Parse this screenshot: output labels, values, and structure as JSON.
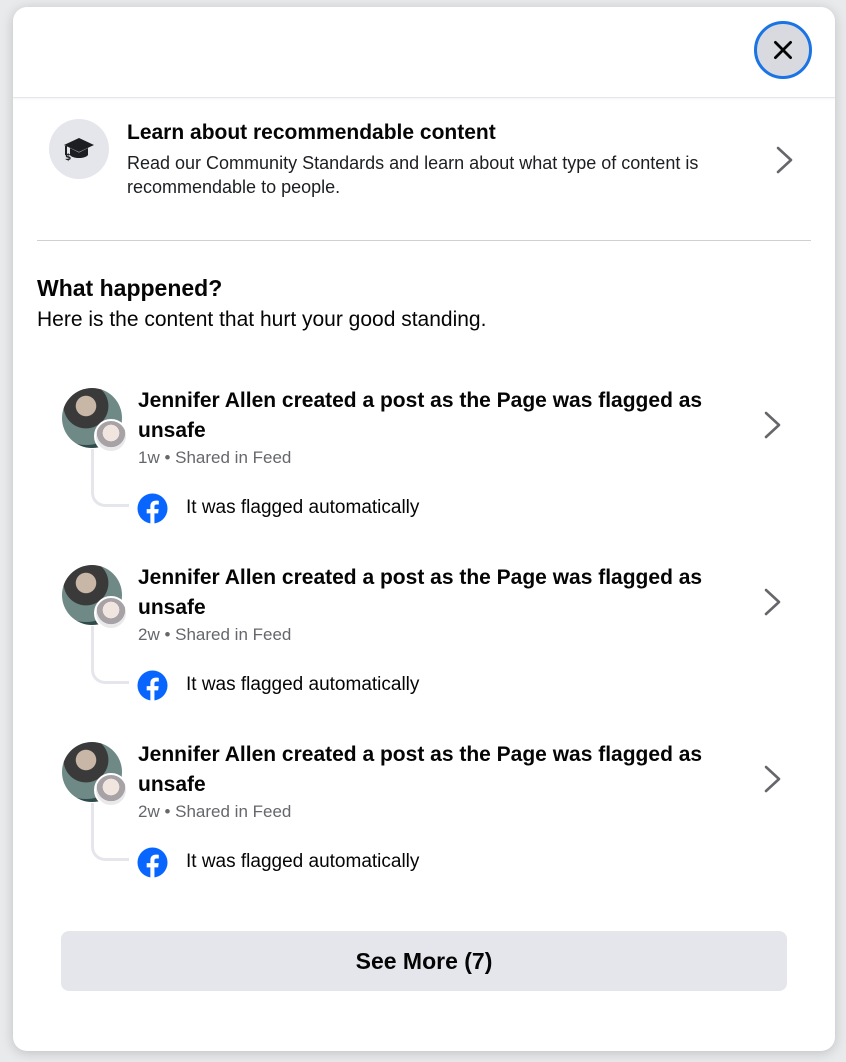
{
  "learn": {
    "icon": "graduation-cap-icon",
    "title": "Learn about recommendable content",
    "description": "Read our Community Standards and learn about what type of content is recommendable to people."
  },
  "section": {
    "title": "What happened?",
    "subtitle": "Here is the content that hurt your good standing."
  },
  "items": [
    {
      "title": "Jennifer Allen created a post as the Page was flagged as unsafe",
      "meta": "1w • Shared in Feed",
      "flag_text": "It was flagged automatically"
    },
    {
      "title": "Jennifer Allen created a post as the Page was flagged as unsafe",
      "meta": "2w • Shared in Feed",
      "flag_text": "It was flagged automatically"
    },
    {
      "title": "Jennifer Allen created a post as the Page was flagged as unsafe",
      "meta": "2w • Shared in Feed",
      "flag_text": "It was flagged automatically"
    }
  ],
  "see_more_label": "See More (7)",
  "colors": {
    "facebook_blue": "#0866ff",
    "focus_ring": "#1b74e4",
    "secondary_text": "#65676b",
    "button_gray": "#e4e6eb"
  }
}
